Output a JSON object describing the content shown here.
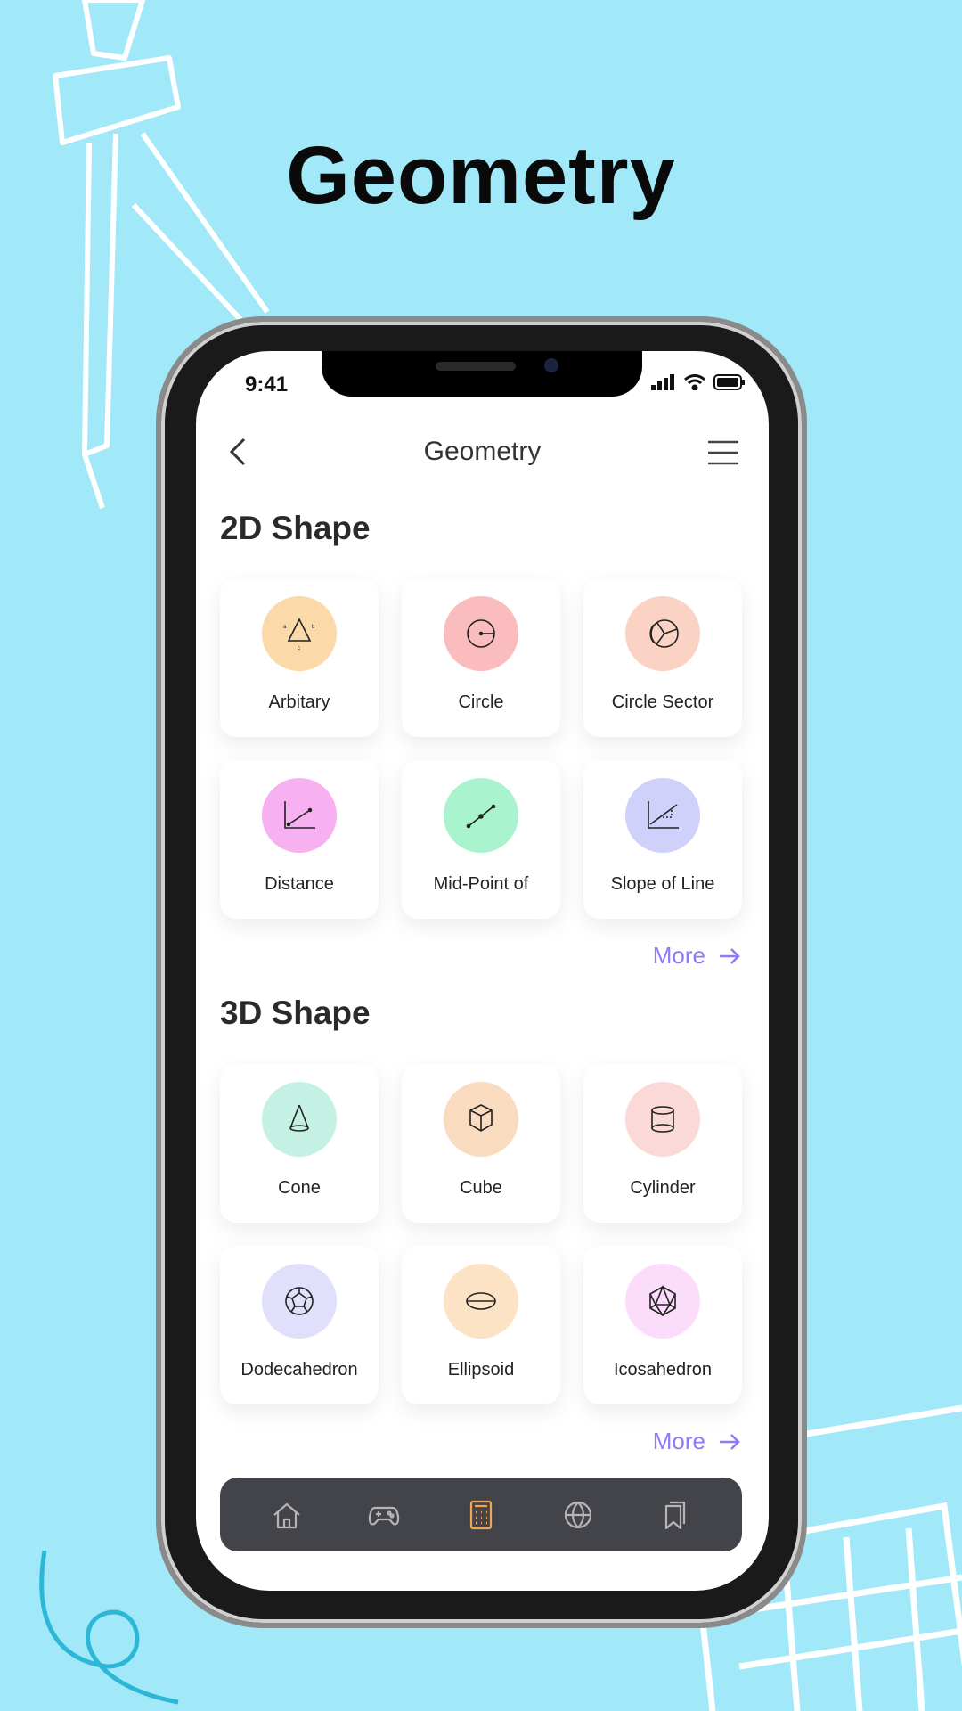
{
  "headline": "Geometry",
  "status_bar": {
    "time": "9:41"
  },
  "nav": {
    "title": "Geometry"
  },
  "sections": [
    {
      "title": "2D Shape",
      "more": "More",
      "items": [
        {
          "label": "Arbitary",
          "icon": "triangle-icon",
          "color": "#fbd9a8"
        },
        {
          "label": "Circle",
          "icon": "circle-radius-icon",
          "color": "#fbbcbd"
        },
        {
          "label": "Circle Sector",
          "icon": "circle-sector-icon",
          "color": "#fbd3c5"
        },
        {
          "label": "Distance",
          "icon": "distance-graph-icon",
          "color": "#f7b0f0"
        },
        {
          "label": "Mid-Point of",
          "icon": "midpoint-icon",
          "color": "#a9f3cf"
        },
        {
          "label": "Slope of Line",
          "icon": "slope-icon",
          "color": "#cfd1fa"
        }
      ]
    },
    {
      "title": "3D Shape",
      "more": "More",
      "items": [
        {
          "label": "Cone",
          "icon": "cone-icon",
          "color": "#c5f1e4"
        },
        {
          "label": "Cube",
          "icon": "cube-icon",
          "color": "#f9dcc0"
        },
        {
          "label": "Cylinder",
          "icon": "cylinder-icon",
          "color": "#fcd9d9"
        },
        {
          "label": "Dodecahedron",
          "icon": "dodecahedron-icon",
          "color": "#e0e0fc"
        },
        {
          "label": "Ellipsoid",
          "icon": "ellipsoid-icon",
          "color": "#fde3c6"
        },
        {
          "label": "Icosahedron",
          "icon": "icosahedron-icon",
          "color": "#fbdcfb"
        }
      ]
    }
  ],
  "tabbar": {
    "items": [
      "home-icon",
      "gamepad-icon",
      "calculator-icon",
      "globe-icon",
      "bookmarks-icon"
    ],
    "active": 2,
    "active_color": "#f0a550",
    "inactive_color": "#b5b5b8"
  },
  "colors": {
    "background": "#a1e8f9",
    "accent": "#8b7cf6"
  }
}
